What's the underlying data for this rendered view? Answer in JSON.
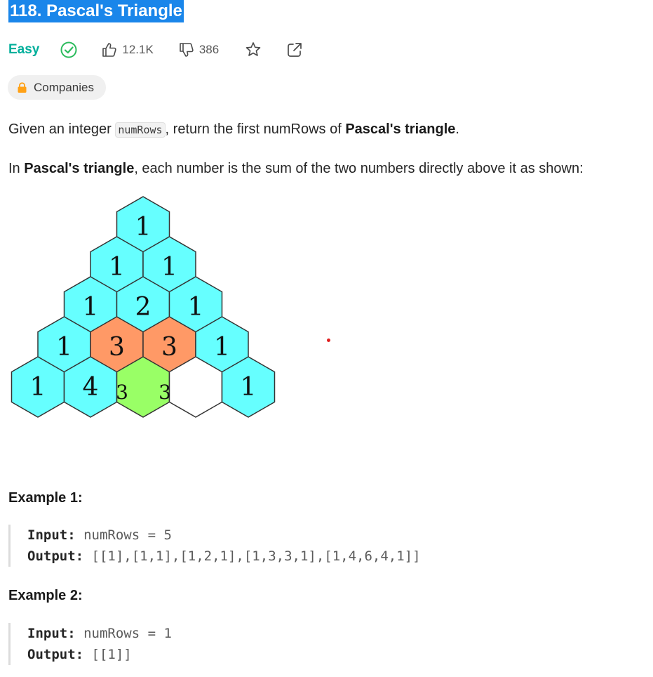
{
  "problem": {
    "title": "118. Pascal's Triangle",
    "difficulty": "Easy",
    "likes": "12.1K",
    "dislikes": "386",
    "companies_label": "Companies"
  },
  "description": {
    "p1_before": "Given an integer ",
    "p1_code": "numRows",
    "p1_middle": ", return the first numRows of ",
    "p1_bold": "Pascal's triangle",
    "p1_end": ".",
    "p2_before": "In ",
    "p2_bold": "Pascal's triangle",
    "p2_after": ", each number is the sum of the two numbers directly above it as shown:"
  },
  "triangle": {
    "rows": [
      [
        "1"
      ],
      [
        "1",
        "1"
      ],
      [
        "1",
        "2",
        "1"
      ],
      [
        "1",
        "3",
        "3",
        "1"
      ],
      [
        "1",
        "4",
        "",
        "",
        "1"
      ]
    ],
    "small_labels": [
      "3",
      "3"
    ],
    "colors": {
      "cyan": "#66ffff",
      "orange": "#ff9966",
      "green": "#99ff66",
      "white": "#ffffff"
    }
  },
  "examples": [
    {
      "title": "Example 1:",
      "input_label": "Input:",
      "input_value": "numRows = 5",
      "output_label": "Output:",
      "output_value": "[[1],[1,1],[1,2,1],[1,3,3,1],[1,4,6,4,1]]"
    },
    {
      "title": "Example 2:",
      "input_label": "Input:",
      "input_value": "numRows = 1",
      "output_label": "Output:",
      "output_value": "[[1]]"
    }
  ],
  "icons": {
    "solved": "check-circle-icon",
    "like": "thumbs-up-icon",
    "dislike": "thumbs-down-icon",
    "favorite": "star-icon",
    "share": "share-icon",
    "lock": "lock-icon"
  }
}
